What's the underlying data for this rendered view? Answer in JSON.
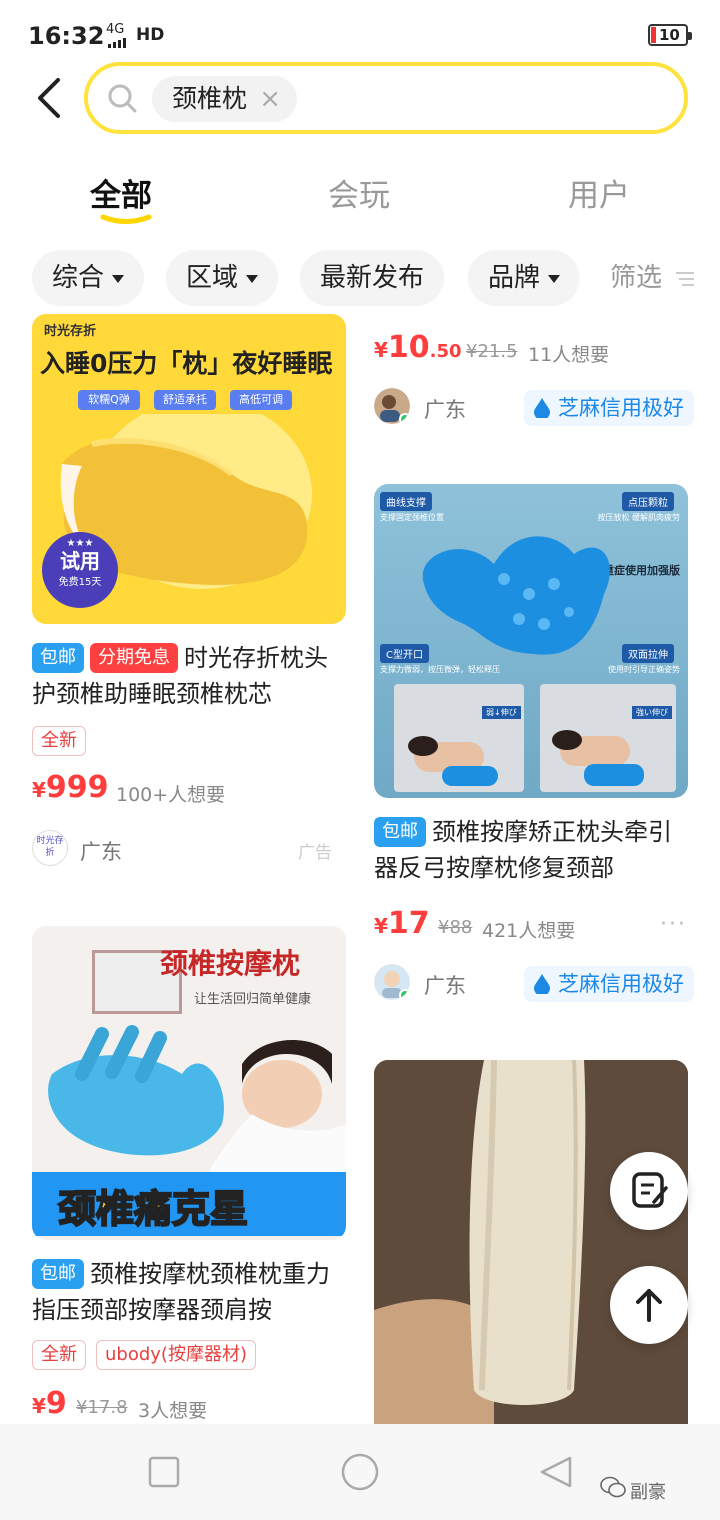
{
  "status": {
    "time": "16:32",
    "network": "4G",
    "hd": "HD",
    "battery": "10"
  },
  "search": {
    "query": "颈椎枕"
  },
  "tabs": [
    "全部",
    "会玩",
    "用户"
  ],
  "filters": [
    "综合",
    "区域",
    "最新发布",
    "品牌",
    "筛选"
  ],
  "colors": {
    "accent": "#ffe23d",
    "price": "#ff3d3d",
    "tag_blue": "#2aa1f0",
    "credit": "#1e88e5"
  },
  "cards": [
    {
      "image": {
        "brand": "时光存折",
        "headline": "入睡0压力「枕」夜好睡眠",
        "features": [
          "软糯Q弹",
          "舒适承托",
          "高低可调"
        ],
        "badge": "试用",
        "badge_sub": "免费15天"
      },
      "tags": [
        "包邮",
        "分期免息"
      ],
      "title": "时光存折枕头护颈椎助睡眠颈椎枕芯",
      "outline_tags": [
        "全新"
      ],
      "price_symbol": "¥",
      "price": "999",
      "wants": "100+人想要",
      "location": "广东",
      "ad": "广告",
      "avatar_text": "时光存折"
    },
    {
      "price_symbol": "¥",
      "price_int": "10",
      "price_dec": ".50",
      "old_price": "¥21.5",
      "wants": "11人想要",
      "location": "广东",
      "credit": "芝麻信用极好"
    },
    {
      "image": {
        "labels": [
          "曲线支撑",
          "支撑固定颈椎位置",
          "点压颗粒",
          "按压放松 缓解肌肉疲劳",
          "重症使用加强版",
          "C型开口",
          "支撑力微弱，按压微弹，轻松释压",
          "双面拉伸",
          "使用时引导正确姿势",
          "弱↓伸び",
          "強い伸び"
        ]
      },
      "tags": [
        "包邮"
      ],
      "title": "颈椎按摩矫正枕头牵引器反弓按摩枕修复颈部",
      "price_symbol": "¥",
      "price": "17",
      "old_price": "¥88",
      "wants": "421人想要",
      "location": "广东",
      "credit": "芝麻信用极好",
      "more": "···"
    },
    {
      "image": {
        "headline": "颈椎按摩枕",
        "sub": "让生活回归简单健康",
        "banner": "颈椎痛克星"
      },
      "tags": [
        "包邮"
      ],
      "title": "颈椎按摩枕颈椎枕重力指压颈部按摩器颈肩按",
      "outline_tags": [
        "全新",
        "ubody(按摩器材)"
      ],
      "price_symbol": "¥",
      "price": "9",
      "old_price": "¥17.8",
      "wants": "3人想要"
    }
  ],
  "watermark": "副豪"
}
